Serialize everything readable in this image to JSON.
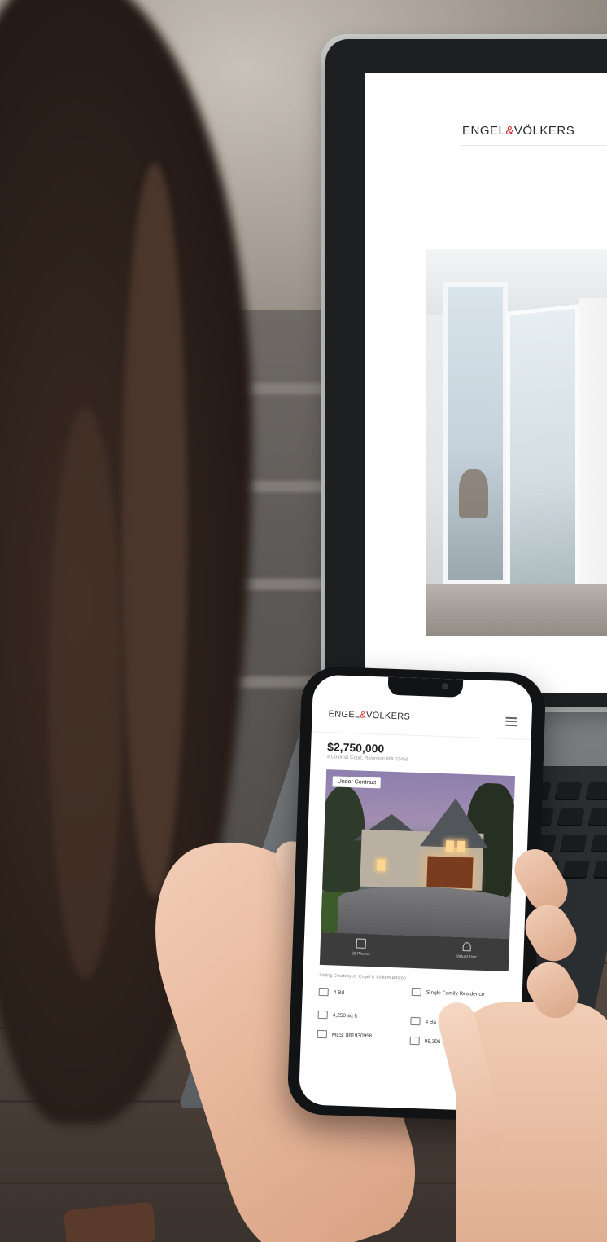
{
  "laptop": {
    "logo_left": "ENGEL",
    "logo_amp": "&",
    "logo_right": "VÖLKERS"
  },
  "phone": {
    "logo_left": "ENGEL",
    "logo_amp": "&",
    "logo_right": "VÖLKERS",
    "price": "$2,750,000",
    "address": "4 Colonial Court, Riverside MA 02456",
    "badge": "Under Contract",
    "photo_bar": {
      "left_label": "28 Photos",
      "right_label": "Virtual Tour"
    },
    "listing_courtesy": "Listing Courtesy of: Engel & Völkers Boston",
    "facts": {
      "beds": "4 Bd",
      "type": "Single Family Residence",
      "sqft": "4,250 sq ft",
      "baths": "4 Ba",
      "mls": "MLS: 881930956",
      "lot": "98,306 SqMt Lot"
    }
  }
}
